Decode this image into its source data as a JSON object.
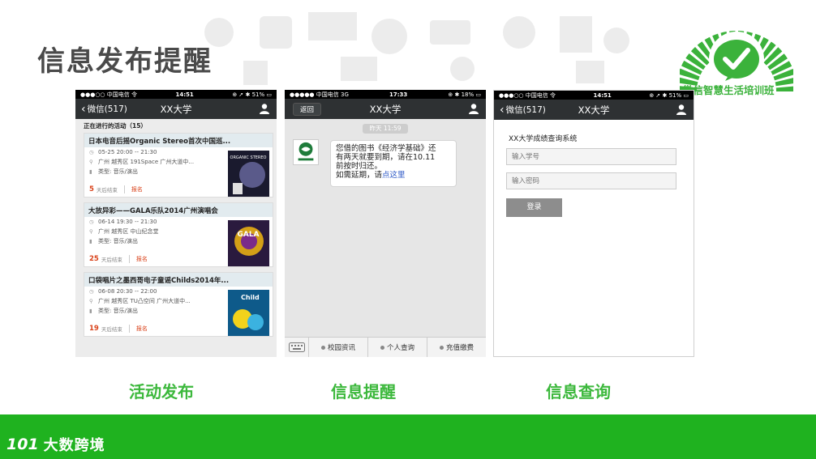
{
  "slide": {
    "title": "信息发布提醒"
  },
  "logo": {
    "text": "微信智慧生活培训班"
  },
  "phone1": {
    "status": {
      "carrier": "●●●○○ 中国电信 令",
      "time": "14:51",
      "right": "⊕ ➚ ✱ 51% ▭"
    },
    "nav": {
      "back": "微信(517)",
      "title": "XX大学"
    },
    "section_label": "正在进行的活动（15）",
    "events": [
      {
        "title": "日本电音后摇Organic Stereo首次中国巡...",
        "time": "05-25 20:00 -- 21:30",
        "place": "广州 越秀区 191Space 广州大道中...",
        "type": "类型: 音乐/演出",
        "days": "5",
        "days_label": "天后结束",
        "signup": "报名"
      },
      {
        "title": "大放异彩——GALA乐队2014广州演唱会",
        "time": "06-14 19:30 -- 21:30",
        "place": "广州 越秀区 中山纪念堂",
        "type": "类型: 音乐/演出",
        "days": "25",
        "days_label": "天后结束",
        "signup": "报名"
      },
      {
        "title": "口袋唱片之墨西哥电子童谣Childs2014年...",
        "time": "06-08 20:30 -- 22:00",
        "place": "广州 越秀区 TU凸空间 广州大道中...",
        "type": "类型: 音乐/演出",
        "days": "19",
        "days_label": "天后结束",
        "signup": "报名"
      }
    ]
  },
  "phone2": {
    "status": {
      "carrier": "●●●●● 中国电信 3G",
      "time": "17:33",
      "right": "⊕ ✱ 18% ▭"
    },
    "nav": {
      "back": "返回",
      "title": "XX大学"
    },
    "time_chip": "昨天 11:59",
    "message": {
      "line1": "您借的图书《经济学基础》还",
      "line2": "有两天就要到期，请在10.11",
      "line3": "前按时归还。",
      "line4_prefix": "如需延期，请",
      "line4_link": "点这里"
    },
    "menu": [
      "校园资讯",
      "个人查询",
      "充值缴费"
    ]
  },
  "phone3": {
    "status": {
      "carrier": "●●●○○ 中国电信 令",
      "time": "14:51",
      "right": "⊕ ➚ ✱ 51% ▭"
    },
    "nav": {
      "back": "微信(517)",
      "title": "XX大学"
    },
    "form_title": "XX大学成绩查询系统",
    "id_placeholder": "输入学号",
    "pwd_placeholder": "输入密码",
    "login_label": "登录"
  },
  "captions": {
    "publish": "活动发布",
    "remind": "信息提醒",
    "query": "信息查询"
  },
  "footer": {
    "mark": "101",
    "brand": "大数跨境"
  },
  "colors": {
    "accent_green": "#3cb83c",
    "footer_green": "#1fb21f",
    "nav_dark": "#2e3133",
    "event_red": "#d9421a"
  }
}
